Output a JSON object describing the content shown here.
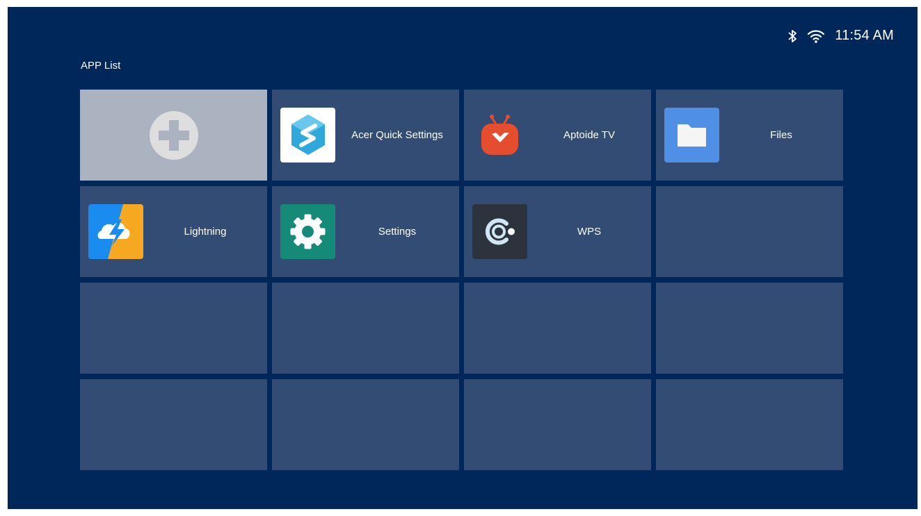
{
  "status_bar": {
    "time": "11:54 AM",
    "icons": [
      "bluetooth-icon",
      "wifi-icon"
    ]
  },
  "page": {
    "title": "APP List"
  },
  "apps": [
    {
      "label": "Acer Quick Settings",
      "icon": "acer-quick-settings-icon"
    },
    {
      "label": "Aptoide TV",
      "icon": "aptoide-tv-icon"
    },
    {
      "label": "Files",
      "icon": "files-icon"
    },
    {
      "label": "Lightning",
      "icon": "lightning-icon"
    },
    {
      "label": "Settings",
      "icon": "settings-icon"
    },
    {
      "label": "WPS",
      "icon": "wps-icon"
    }
  ],
  "add_tile": {
    "icon": "plus-icon"
  },
  "colors": {
    "background": "#00275a",
    "tile": "#324c74",
    "add_tile": "#aab3bf",
    "text": "#ffffff"
  }
}
